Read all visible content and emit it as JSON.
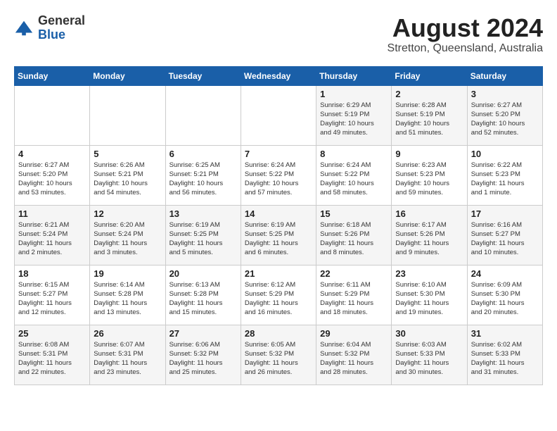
{
  "logo": {
    "general": "General",
    "blue": "Blue"
  },
  "title": {
    "month_year": "August 2024",
    "location": "Stretton, Queensland, Australia"
  },
  "header_days": [
    "Sunday",
    "Monday",
    "Tuesday",
    "Wednesday",
    "Thursday",
    "Friday",
    "Saturday"
  ],
  "weeks": [
    [
      {
        "day": "",
        "info": ""
      },
      {
        "day": "",
        "info": ""
      },
      {
        "day": "",
        "info": ""
      },
      {
        "day": "",
        "info": ""
      },
      {
        "day": "1",
        "info": "Sunrise: 6:29 AM\nSunset: 5:19 PM\nDaylight: 10 hours\nand 49 minutes."
      },
      {
        "day": "2",
        "info": "Sunrise: 6:28 AM\nSunset: 5:19 PM\nDaylight: 10 hours\nand 51 minutes."
      },
      {
        "day": "3",
        "info": "Sunrise: 6:27 AM\nSunset: 5:20 PM\nDaylight: 10 hours\nand 52 minutes."
      }
    ],
    [
      {
        "day": "4",
        "info": "Sunrise: 6:27 AM\nSunset: 5:20 PM\nDaylight: 10 hours\nand 53 minutes."
      },
      {
        "day": "5",
        "info": "Sunrise: 6:26 AM\nSunset: 5:21 PM\nDaylight: 10 hours\nand 54 minutes."
      },
      {
        "day": "6",
        "info": "Sunrise: 6:25 AM\nSunset: 5:21 PM\nDaylight: 10 hours\nand 56 minutes."
      },
      {
        "day": "7",
        "info": "Sunrise: 6:24 AM\nSunset: 5:22 PM\nDaylight: 10 hours\nand 57 minutes."
      },
      {
        "day": "8",
        "info": "Sunrise: 6:24 AM\nSunset: 5:22 PM\nDaylight: 10 hours\nand 58 minutes."
      },
      {
        "day": "9",
        "info": "Sunrise: 6:23 AM\nSunset: 5:23 PM\nDaylight: 10 hours\nand 59 minutes."
      },
      {
        "day": "10",
        "info": "Sunrise: 6:22 AM\nSunset: 5:23 PM\nDaylight: 11 hours\nand 1 minute."
      }
    ],
    [
      {
        "day": "11",
        "info": "Sunrise: 6:21 AM\nSunset: 5:24 PM\nDaylight: 11 hours\nand 2 minutes."
      },
      {
        "day": "12",
        "info": "Sunrise: 6:20 AM\nSunset: 5:24 PM\nDaylight: 11 hours\nand 3 minutes."
      },
      {
        "day": "13",
        "info": "Sunrise: 6:19 AM\nSunset: 5:25 PM\nDaylight: 11 hours\nand 5 minutes."
      },
      {
        "day": "14",
        "info": "Sunrise: 6:19 AM\nSunset: 5:25 PM\nDaylight: 11 hours\nand 6 minutes."
      },
      {
        "day": "15",
        "info": "Sunrise: 6:18 AM\nSunset: 5:26 PM\nDaylight: 11 hours\nand 8 minutes."
      },
      {
        "day": "16",
        "info": "Sunrise: 6:17 AM\nSunset: 5:26 PM\nDaylight: 11 hours\nand 9 minutes."
      },
      {
        "day": "17",
        "info": "Sunrise: 6:16 AM\nSunset: 5:27 PM\nDaylight: 11 hours\nand 10 minutes."
      }
    ],
    [
      {
        "day": "18",
        "info": "Sunrise: 6:15 AM\nSunset: 5:27 PM\nDaylight: 11 hours\nand 12 minutes."
      },
      {
        "day": "19",
        "info": "Sunrise: 6:14 AM\nSunset: 5:28 PM\nDaylight: 11 hours\nand 13 minutes."
      },
      {
        "day": "20",
        "info": "Sunrise: 6:13 AM\nSunset: 5:28 PM\nDaylight: 11 hours\nand 15 minutes."
      },
      {
        "day": "21",
        "info": "Sunrise: 6:12 AM\nSunset: 5:29 PM\nDaylight: 11 hours\nand 16 minutes."
      },
      {
        "day": "22",
        "info": "Sunrise: 6:11 AM\nSunset: 5:29 PM\nDaylight: 11 hours\nand 18 minutes."
      },
      {
        "day": "23",
        "info": "Sunrise: 6:10 AM\nSunset: 5:30 PM\nDaylight: 11 hours\nand 19 minutes."
      },
      {
        "day": "24",
        "info": "Sunrise: 6:09 AM\nSunset: 5:30 PM\nDaylight: 11 hours\nand 20 minutes."
      }
    ],
    [
      {
        "day": "25",
        "info": "Sunrise: 6:08 AM\nSunset: 5:31 PM\nDaylight: 11 hours\nand 22 minutes."
      },
      {
        "day": "26",
        "info": "Sunrise: 6:07 AM\nSunset: 5:31 PM\nDaylight: 11 hours\nand 23 minutes."
      },
      {
        "day": "27",
        "info": "Sunrise: 6:06 AM\nSunset: 5:32 PM\nDaylight: 11 hours\nand 25 minutes."
      },
      {
        "day": "28",
        "info": "Sunrise: 6:05 AM\nSunset: 5:32 PM\nDaylight: 11 hours\nand 26 minutes."
      },
      {
        "day": "29",
        "info": "Sunrise: 6:04 AM\nSunset: 5:32 PM\nDaylight: 11 hours\nand 28 minutes."
      },
      {
        "day": "30",
        "info": "Sunrise: 6:03 AM\nSunset: 5:33 PM\nDaylight: 11 hours\nand 30 minutes."
      },
      {
        "day": "31",
        "info": "Sunrise: 6:02 AM\nSunset: 5:33 PM\nDaylight: 11 hours\nand 31 minutes."
      }
    ]
  ]
}
